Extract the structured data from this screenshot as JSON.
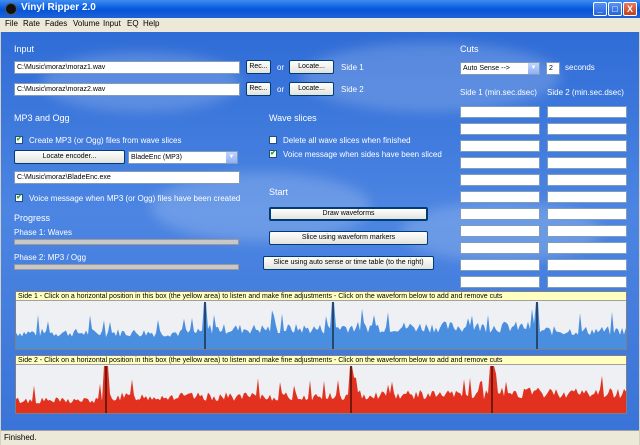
{
  "window": {
    "title": "Vinyl Ripper 2.0",
    "min": "_",
    "max": "□",
    "close": "X"
  },
  "menu": [
    "File",
    "Rate",
    "Fades",
    "Volume",
    "Input",
    "EQ",
    "Help"
  ],
  "input": {
    "heading": "Input",
    "side1_path": "C:\\Music\\moraz\\moraz1.wav",
    "side2_path": "C:\\Music\\moraz\\moraz2.wav",
    "rec_label": "Rec...",
    "or_label": "or",
    "locate_label": "Locate...",
    "side1_label": "Side 1",
    "side2_label": "Side 2"
  },
  "mp3": {
    "heading": "MP3 and Ogg",
    "create_label": "Create MP3 (or Ogg) files from wave slices",
    "create_checked": true,
    "locate_encoder": "Locate encoder...",
    "encoder_selected": "BladeEnc (MP3)",
    "encoder_path": "C:\\Music\\moraz\\BladeEnc.exe",
    "voice_label": "Voice message when MP3 (or Ogg) files have been created",
    "voice_checked": true
  },
  "progress": {
    "heading": "Progress",
    "phase1": "Phase 1: Waves",
    "phase2": "Phase 2: MP3 / Ogg",
    "phase1_value": 0,
    "phase2_value": 0
  },
  "wave_slices": {
    "heading": "Wave slices",
    "delete_label": "Delete all wave slices when finished",
    "delete_checked": false,
    "voice_label": "Voice message when sides have been sliced",
    "voice_checked": true
  },
  "start": {
    "heading": "Start",
    "draw": "Draw waveforms",
    "slice_markers": "Slice using waveform markers",
    "slice_auto": "Slice using auto sense or time table (to the right)"
  },
  "cuts": {
    "heading": "Cuts",
    "mode": "Auto Sense -->",
    "seconds_value": "2",
    "seconds_label": "seconds",
    "side1_col": "Side 1 (min.sec.dsec)",
    "side2_col": "Side 2 (min.sec.dsec)"
  },
  "side1_panel": {
    "header": "Side 1 - Click on a horizontal position in this box (the yellow area) to listen and make fine adjustments - Click on the waveform below to add and remove cuts",
    "color": "#4a8ee0"
  },
  "side2_panel": {
    "header": "Side 2 - Click on a horizontal position in this box (the yellow area) to listen and make fine adjustments - Click on the waveform below to add and remove cuts",
    "color": "#e2321f"
  },
  "status": "Finished."
}
